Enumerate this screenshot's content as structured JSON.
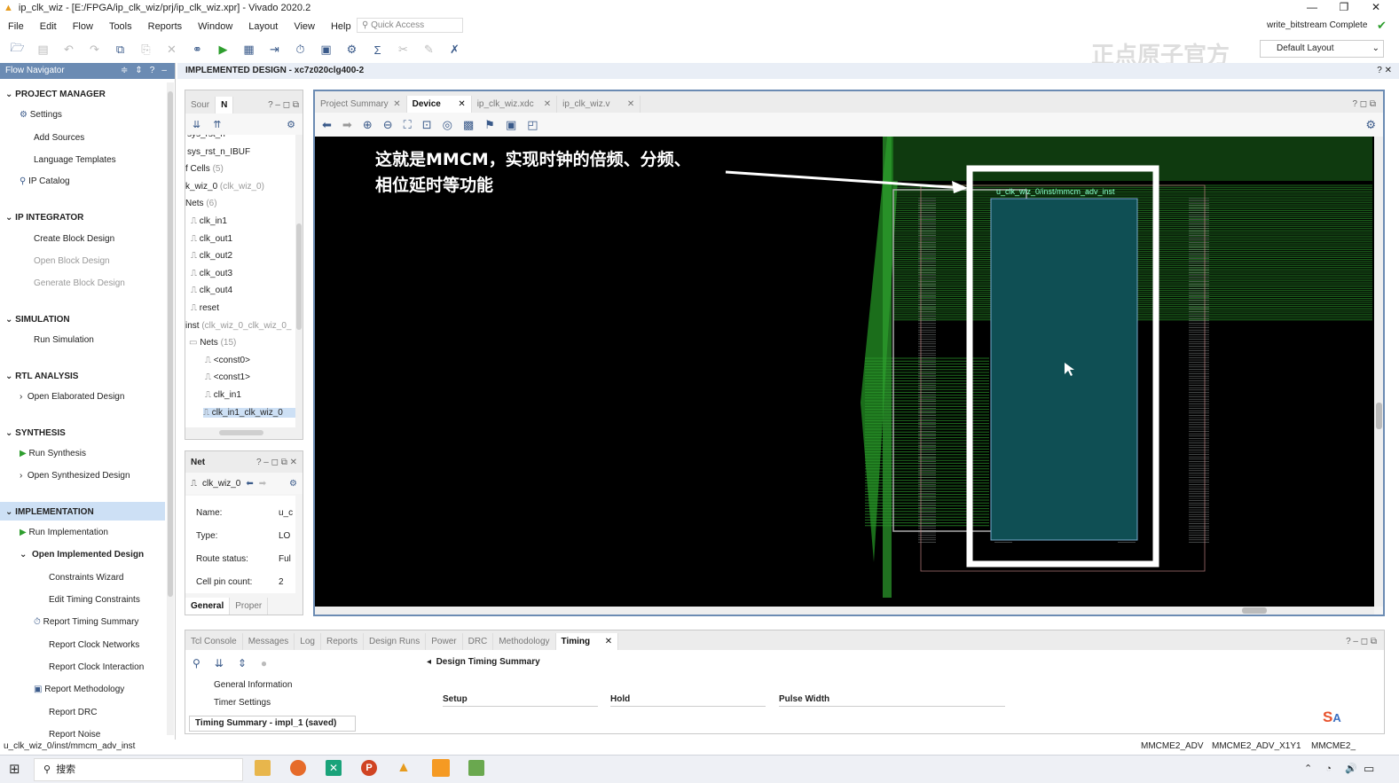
{
  "window": {
    "title": "ip_clk_wiz - [E:/FPGA/ip_clk_wiz/prj/ip_clk_wiz.xpr] - Vivado 2020.2",
    "status_right": "write_bitstream Complete",
    "layout_select": "Default Layout",
    "watermark": "正点原子官方"
  },
  "menu": [
    "File",
    "Edit",
    "Flow",
    "Tools",
    "Reports",
    "Window",
    "Layout",
    "View",
    "Help"
  ],
  "quick_access": "Quick Access",
  "flow_nav": {
    "title": "Flow Navigator",
    "sections": {
      "project_manager": "PROJECT MANAGER",
      "ip_integrator": "IP INTEGRATOR",
      "simulation": "SIMULATION",
      "rtl": "RTL ANALYSIS",
      "synthesis": "SYNTHESIS",
      "implementation": "IMPLEMENTATION"
    },
    "items": {
      "settings": "Settings",
      "add_sources": "Add Sources",
      "lang_templates": "Language Templates",
      "ip_catalog": "IP Catalog",
      "create_bd": "Create Block Design",
      "open_bd": "Open Block Design",
      "gen_bd": "Generate Block Design",
      "run_sim": "Run Simulation",
      "open_elab": "Open Elaborated Design",
      "run_synth": "Run Synthesis",
      "open_synth": "Open Synthesized Design",
      "run_impl": "Run Implementation",
      "open_impl": "Open Implemented Design",
      "constraints_wizard": "Constraints Wizard",
      "edit_timing": "Edit Timing Constraints",
      "report_timing": "Report Timing Summary",
      "report_clock_net": "Report Clock Networks",
      "report_clock_int": "Report Clock Interaction",
      "report_method": "Report Methodology",
      "report_drc": "Report DRC",
      "report_noise": "Report Noise"
    }
  },
  "impl_header": "IMPLEMENTED DESIGN - xc7z020clg400-2",
  "netlist": {
    "tabs": [
      "Sour",
      "N"
    ],
    "rows": [
      {
        "t": "sys_rst_n",
        "g": ""
      },
      {
        "t": "sys_rst_n_IBUF",
        "g": ""
      },
      {
        "t": "f Cells",
        "g": "(5)"
      },
      {
        "t": "k_wiz_0",
        "g": "(clk_wiz_0)"
      },
      {
        "t": "Nets",
        "g": "(6)"
      },
      {
        "t": "clk_in1",
        "g": ""
      },
      {
        "t": "clk_out1",
        "g": ""
      },
      {
        "t": "clk_out2",
        "g": ""
      },
      {
        "t": "clk_out3",
        "g": ""
      },
      {
        "t": "clk_out4",
        "g": ""
      },
      {
        "t": "reset",
        "g": ""
      },
      {
        "t": "inst",
        "g": "(clk_wiz_0_clk_wiz_0_"
      },
      {
        "t": "Nets",
        "g": "(15)"
      },
      {
        "t": "<const0>",
        "g": ""
      },
      {
        "t": "<const1>",
        "g": ""
      },
      {
        "t": "clk_in1",
        "g": ""
      },
      {
        "t": "clk_in1_clk_wiz_0",
        "g": ""
      }
    ]
  },
  "net_props": {
    "title": "Net",
    "current": "clk_wiz_0",
    "rows": [
      {
        "k": "Name:",
        "v": "u_c"
      },
      {
        "k": "Type:",
        "v": "LO"
      },
      {
        "k": "Route status:",
        "v": "Ful"
      },
      {
        "k": "Cell pin count:",
        "v": "2"
      }
    ],
    "tabs": [
      "General",
      "Proper"
    ]
  },
  "editor_tabs": [
    "Project Summary",
    "Device",
    "ip_clk_wiz.xdc",
    "ip_clk_wiz.v"
  ],
  "device": {
    "annotation_line1": "这就是MMCM，实现时钟的倍频、分频、",
    "annotation_line2": "相位延时等功能",
    "cell_label": "u_clk_wiz_0/inst/mmcm_adv_inst",
    "colors": {
      "bg": "#000000",
      "green": "#2ea02e",
      "cell": "#0f4f54",
      "frame": "#ffffff"
    }
  },
  "bottom_tabs": [
    "Tcl Console",
    "Messages",
    "Log",
    "Reports",
    "Design Runs",
    "Power",
    "DRC",
    "Methodology",
    "Timing"
  ],
  "timing": {
    "summary_title": "Design Timing Summary",
    "tree": [
      "General Information",
      "Timer Settings"
    ],
    "cols": [
      "Setup",
      "Hold",
      "Pulse Width"
    ],
    "run_tab": "Timing Summary - impl_1 (saved)"
  },
  "status": {
    "left": "u_clk_wiz_0/inst/mmcm_adv_inst",
    "r1": "MMCME2_ADV",
    "r2": "MMCME2_ADV_X1Y1",
    "r3": "MMCME2_"
  },
  "taskbar": {
    "search": "搜索"
  }
}
